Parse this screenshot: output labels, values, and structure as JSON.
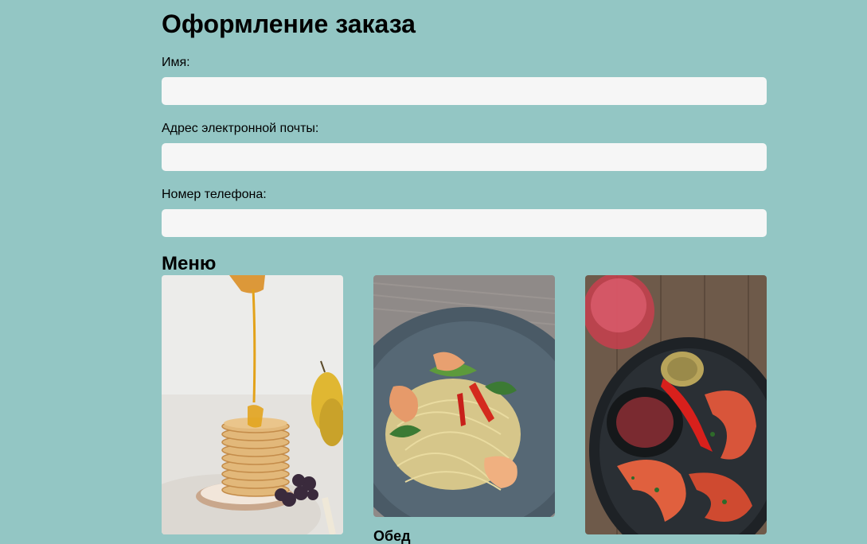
{
  "form": {
    "title": "Оформление заказа",
    "fields": [
      {
        "label": "Имя:",
        "value": "",
        "placeholder": ""
      },
      {
        "label": "Адрес электронной почты:",
        "value": "",
        "placeholder": ""
      },
      {
        "label": "Номер телефона:",
        "value": "",
        "placeholder": ""
      }
    ]
  },
  "menu": {
    "title": "Меню",
    "items": [
      {
        "image": "pancakes-photo",
        "caption": ""
      },
      {
        "image": "shrimp-pasta-photo",
        "caption": "Обед"
      },
      {
        "image": "grilled-shrimp-photo",
        "caption": ""
      }
    ]
  },
  "colors": {
    "background": "#93c6c4",
    "input_background": "#f6f6f6"
  }
}
